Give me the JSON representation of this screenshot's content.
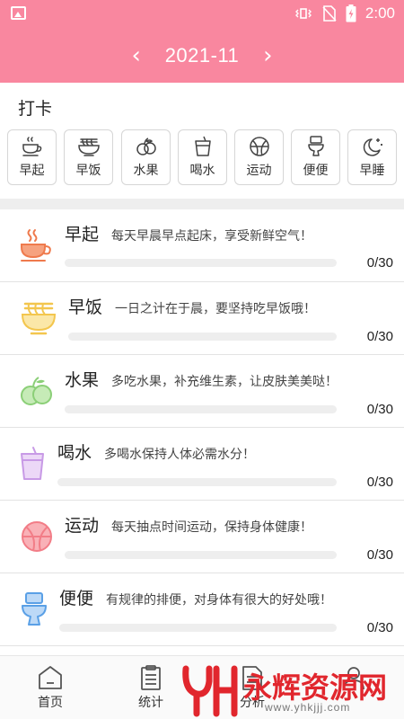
{
  "status_bar": {
    "time": "2:00"
  },
  "header": {
    "month": "2021-11",
    "prev_icon": "chevron-left-icon",
    "next_icon": "chevron-right-icon",
    "bg_color": "#f9879f"
  },
  "checkin": {
    "title": "打卡",
    "chips": [
      {
        "label": "早起",
        "icon": "coffee-cup-icon"
      },
      {
        "label": "早饭",
        "icon": "noodle-bowl-icon"
      },
      {
        "label": "水果",
        "icon": "fruit-icon"
      },
      {
        "label": "喝水",
        "icon": "drink-cup-icon"
      },
      {
        "label": "运动",
        "icon": "ball-icon"
      },
      {
        "label": "便便",
        "icon": "toilet-icon"
      },
      {
        "label": "早睡",
        "icon": "moon-stars-icon"
      }
    ]
  },
  "habits": [
    {
      "title": "早起",
      "desc": "每天早晨早点起床，享受新鲜空气！",
      "count": "0/30",
      "progress": 0,
      "icon": "coffee-cup-icon",
      "color": "#ef7a4d"
    },
    {
      "title": "早饭",
      "desc": "一日之计在于晨，要坚持吃早饭哦！",
      "count": "0/30",
      "progress": 0,
      "icon": "noodle-bowl-icon",
      "color": "#f3c64e"
    },
    {
      "title": "水果",
      "desc": "多吃水果，补充维生素，让皮肤美美哒！",
      "count": "0/30",
      "progress": 0,
      "icon": "fruit-icon",
      "color": "#8bcf77"
    },
    {
      "title": "喝水",
      "desc": "多喝水保持人体必需水分！",
      "count": "0/30",
      "progress": 0,
      "icon": "drink-cup-icon",
      "color": "#c89ae6"
    },
    {
      "title": "运动",
      "desc": "每天抽点时间运动，保持身体健康！",
      "count": "0/30",
      "progress": 0,
      "icon": "ball-icon",
      "color": "#f27d87"
    },
    {
      "title": "便便",
      "desc": "有规律的排便，对身体有很大的好处哦！",
      "count": "0/30",
      "progress": 0,
      "icon": "toilet-icon",
      "color": "#5aa0e6"
    }
  ],
  "tabbar": {
    "tabs": [
      {
        "label": "首页",
        "icon": "home-icon"
      },
      {
        "label": "统计",
        "icon": "clipboard-icon"
      },
      {
        "label": "分析",
        "icon": "document-icon"
      },
      {
        "label": "",
        "icon": "profile-icon"
      }
    ]
  },
  "watermark": {
    "text": "永辉资源网",
    "url": "www.yhkjjj.com",
    "color": "#e1262d"
  }
}
